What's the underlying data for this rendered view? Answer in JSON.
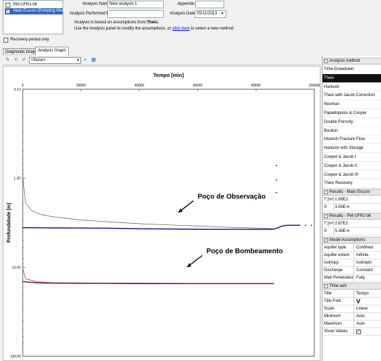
{
  "wells": [
    {
      "label": "PM-UFRJ-06",
      "checked": false,
      "selected": false
    },
    {
      "label": "Mato Escuro (Pumping Well)",
      "checked": true,
      "selected": true
    }
  ],
  "recovery": {
    "label": "Recovery period only"
  },
  "form": {
    "analysis_name_label": "Analysis Name",
    "analysis_name_value": "New analysis 1",
    "appendix_label": "Appendix",
    "performed_by_label": "Analysis Performed by",
    "date_label": "Analysis Date",
    "date_value": "05/11/2013"
  },
  "info": {
    "line1_prefix": "Analysis is based on assumptions from ",
    "line1_method": "Theis.",
    "line2_prefix": "Use the Analysis panel to modify the assumptions, or ",
    "line2_link": "click here",
    "line2_suffix": " to select a new method."
  },
  "tabs": [
    {
      "label": "Diagnostic Graph",
      "active": false
    },
    {
      "label": "Analysis Graph",
      "active": true
    }
  ],
  "toolbar": {
    "select_value": "<None>"
  },
  "chart_data": {
    "type": "scatter",
    "x_label": "Tempo [min]",
    "y_label": "Profundidade [m]",
    "x_ticks": [
      "0",
      "20000",
      "40000",
      "60000",
      "80000",
      "100000"
    ],
    "y_ticks": [
      "0.10",
      "1.00",
      "10.00",
      "100.00"
    ],
    "xlim": [
      0,
      100000
    ],
    "ylim": [
      0.1,
      100
    ],
    "y_scale": "log",
    "y_inverted": true,
    "x_axis_position": "top",
    "annotations": [
      {
        "text": "Poço de Observação",
        "x": 60000,
        "y": 1.7
      },
      {
        "text": "Poço de Bombeamento",
        "x": 63000,
        "y": 7.0
      }
    ],
    "series": [
      {
        "role": "observation-data",
        "color": "#1a1a8a",
        "x": [
          0,
          5000,
          10000,
          20000,
          30000,
          40000,
          50000,
          60000,
          70000,
          80000,
          85000,
          86500,
          88000,
          89000,
          90000,
          91000,
          93000,
          95000
        ],
        "y": [
          3.6,
          3.6,
          3.62,
          3.63,
          3.65,
          3.7,
          3.72,
          3.75,
          3.75,
          3.75,
          3.75,
          3.7,
          3.55,
          3.45,
          3.4,
          3.38,
          3.38,
          3.38
        ]
      },
      {
        "role": "observation-outliers",
        "color": "#1a1a8a",
        "x": [
          87000,
          87000,
          87000
        ],
        "y": [
          0.72,
          1.05,
          1.45
        ]
      },
      {
        "role": "observation-fit",
        "color": "#555555",
        "mode": "line",
        "x": [
          100,
          1000,
          3000,
          6000,
          10000,
          20000,
          30000,
          40000,
          50000,
          60000,
          70000,
          80000,
          86000
        ],
        "y": [
          1.0,
          1.9,
          2.3,
          2.55,
          2.7,
          2.95,
          3.1,
          3.25,
          3.35,
          3.45,
          3.55,
          3.62,
          3.7
        ]
      },
      {
        "role": "pumping-data",
        "color": "#7a2020",
        "x": [
          0,
          5000,
          10000,
          20000,
          30000,
          40000,
          50000,
          60000,
          70000,
          80000,
          86000
        ],
        "y": [
          14.5,
          15.0,
          15.1,
          15.2,
          15.2,
          15.3,
          15.3,
          15.3,
          15.3,
          15.3,
          15.3
        ]
      },
      {
        "role": "pumping-fit",
        "color": "#444444",
        "mode": "line",
        "x": [
          100,
          1000,
          5000,
          10000,
          20000,
          40000,
          60000,
          80000,
          86000
        ],
        "y": [
          10.5,
          13.5,
          14.6,
          14.9,
          15.0,
          15.1,
          15.2,
          15.2,
          15.2
        ]
      }
    ]
  },
  "panel": {
    "method_header": "Analysis method",
    "methods": [
      "Time-Drawdown",
      "Theis",
      "Hantush",
      "Theis with Jacob Correction",
      "Neuman",
      "Papadopulos & Cooper",
      "Double Porosity",
      "Boulton",
      "Moench Fracture Flow",
      "Hantush with Storage",
      "Cooper & Jacob I",
      "Cooper & Jacob II",
      "Cooper & Jacob III",
      "Theis Recovery"
    ],
    "selected_method": "Theis",
    "results1_header": "Results - Mato Escuro",
    "results1": [
      {
        "k": "T [m²/d]",
        "v": "1.99E2"
      },
      {
        "k": "S",
        "v": "3.59E-4"
      }
    ],
    "results2_header": "Results - PM-UFRJ-06",
    "results2": [
      {
        "k": "T [m²/d]",
        "v": "2.67E2"
      },
      {
        "k": "S",
        "v": "5.36E-4"
      }
    ],
    "assumptions_header": "Model Assumptions",
    "assumptions": [
      {
        "k": "Aquifer type",
        "v": "Confined"
      },
      {
        "k": "Aquifer extent",
        "v": "Infinite"
      },
      {
        "k": "Isotropy",
        "v": "Isotropic"
      },
      {
        "k": "Discharge",
        "v": "Constant"
      },
      {
        "k": "Well Penetration",
        "v": "Fully"
      }
    ],
    "time_axis_header": "Time axis",
    "time_axis": [
      {
        "k": "Title",
        "v": "Tempo"
      },
      {
        "k": "Title Font",
        "v": "V"
      },
      {
        "k": "Scale",
        "v": "Linear"
      },
      {
        "k": "Minimum",
        "v": "Auto"
      },
      {
        "k": "Maximum",
        "v": "Auto"
      },
      {
        "k": "Show Values",
        "v": "checked"
      }
    ]
  }
}
